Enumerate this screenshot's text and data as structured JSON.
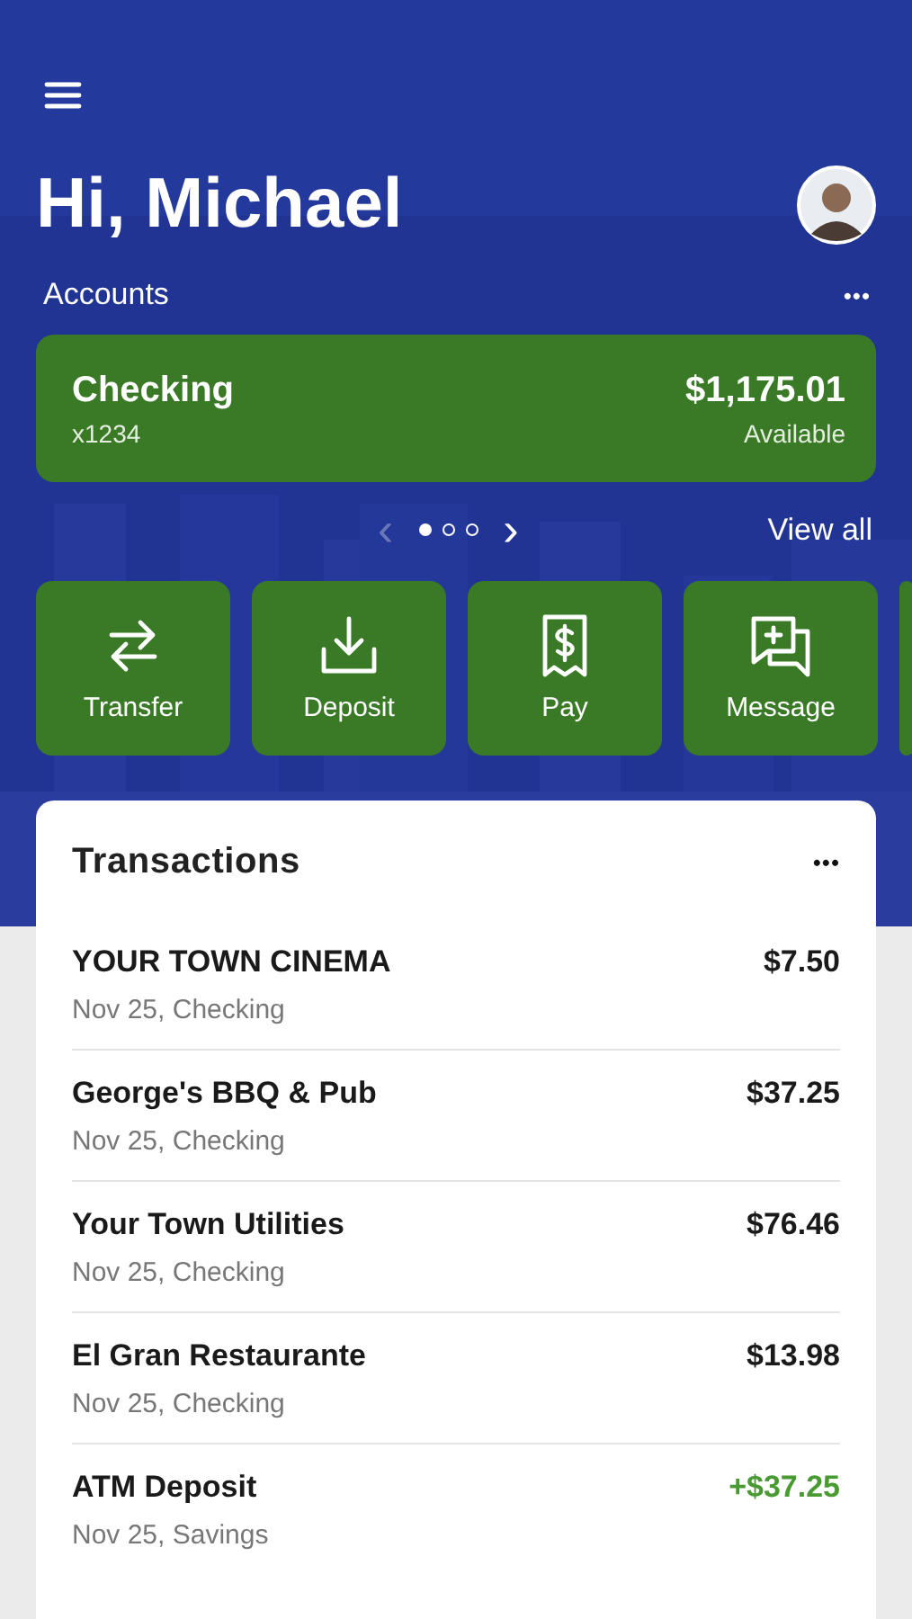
{
  "greeting": "Hi, Michael",
  "accounts": {
    "title": "Accounts",
    "more": "•••",
    "card": {
      "name": "Checking",
      "number": "x1234",
      "balance": "$1,175.01",
      "balance_label": "Available"
    },
    "pager": {
      "previous": "‹",
      "next": "›",
      "pages": [
        {
          "selected": true
        },
        {
          "selected": false
        },
        {
          "selected": false
        }
      ],
      "previous_disabled": true
    },
    "view_all": "View all"
  },
  "actions": [
    {
      "kind": "transfer",
      "label": "Transfer"
    },
    {
      "kind": "deposit",
      "label": "Deposit"
    },
    {
      "kind": "pay",
      "label": "Pay"
    },
    {
      "kind": "message",
      "label": "Message"
    }
  ],
  "transactions": {
    "title": "Transactions",
    "more": "•••",
    "rows": [
      {
        "name": "YOUR TOWN CINEMA",
        "detail": "Nov 25, Checking",
        "amount": "$7.50",
        "kind": "debit"
      },
      {
        "name": "George's BBQ & Pub",
        "detail": "Nov 25, Checking",
        "amount": "$37.25",
        "kind": "debit"
      },
      {
        "name": "Your Town Utilities",
        "detail": "Nov 25, Checking",
        "amount": "$76.46",
        "kind": "debit"
      },
      {
        "name": "El Gran Restaurante",
        "detail": "Nov 25, Checking",
        "amount": "$13.98",
        "kind": "debit"
      },
      {
        "name": "ATM Deposit",
        "detail": "Nov 25, Savings",
        "amount": "+$37.25",
        "kind": "credit"
      }
    ]
  }
}
